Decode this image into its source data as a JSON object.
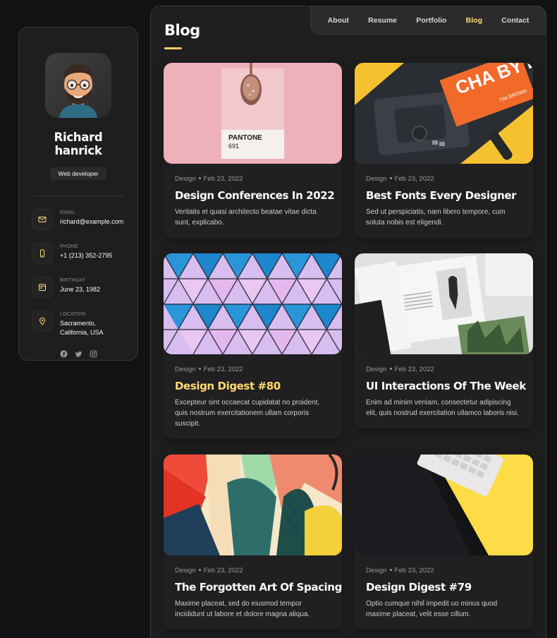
{
  "profile": {
    "name": "Richard hanrick",
    "role": "Web developer",
    "contacts": [
      {
        "label": "EMAIL",
        "value": "richard@example.com",
        "icon": "mail-icon"
      },
      {
        "label": "PHONE",
        "value": "+1 (213) 352-2795",
        "icon": "phone-icon"
      },
      {
        "label": "BIRTHDAY",
        "value": "June 23, 1982",
        "icon": "calendar-icon"
      },
      {
        "label": "LOCATION",
        "value": "Sacramento, California, USA",
        "icon": "location-icon"
      }
    ],
    "socials": [
      "facebook-icon",
      "twitter-icon",
      "instagram-icon"
    ]
  },
  "nav": {
    "items": [
      "About",
      "Resume",
      "Portfolio",
      "Blog",
      "Contact"
    ],
    "active": "Blog"
  },
  "page": {
    "title": "Blog"
  },
  "posts": [
    {
      "category": "Design",
      "date": "Feb 23, 2022",
      "title": "Design Conferences In 2022",
      "excerpt": "Veritatis et quasi architecto beatae vitae dicta sunt, explicabo."
    },
    {
      "category": "Design",
      "date": "Feb 23, 2022",
      "title": "Best Fonts Every Designer",
      "excerpt": "Sed ut perspiciatis, nam libero tempore, cum soluta nobis est eligendi."
    },
    {
      "category": "Design",
      "date": "Feb 23, 2022",
      "title": "Design Digest #80",
      "excerpt": "Excepteur sint occaecat cupidatat no proident, quis nostrum exercitationem ullam corporis suscipit."
    },
    {
      "category": "Design",
      "date": "Feb 23, 2022",
      "title": "UI Interactions Of The Week",
      "excerpt": "Enim ad minim veniam, consectetur adipiscing elit, quis nostrud exercitation ullamco laboris nisi."
    },
    {
      "category": "Design",
      "date": "Feb 23, 2022",
      "title": "The Forgotten Art Of Spacing",
      "excerpt": "Maxime placeat, sed do eiusmod tempor incididunt ut labore et dolore magna aliqua."
    },
    {
      "category": "Design",
      "date": "Feb 23, 2022",
      "title": "Design Digest #79",
      "excerpt": "Optio cumque nihil impedit uo minus quod maxime placeat, velit esse cillum."
    }
  ],
  "image_text": {
    "pantone_brand": "PANTONE",
    "pantone_code": "691",
    "book_title": "CHA BY DESIGN",
    "book_author": "TIM BROWN"
  },
  "colors": {
    "accent": "#ffdb70",
    "card": "#202022",
    "panel": "#1e1e1f",
    "page": "#121212"
  }
}
